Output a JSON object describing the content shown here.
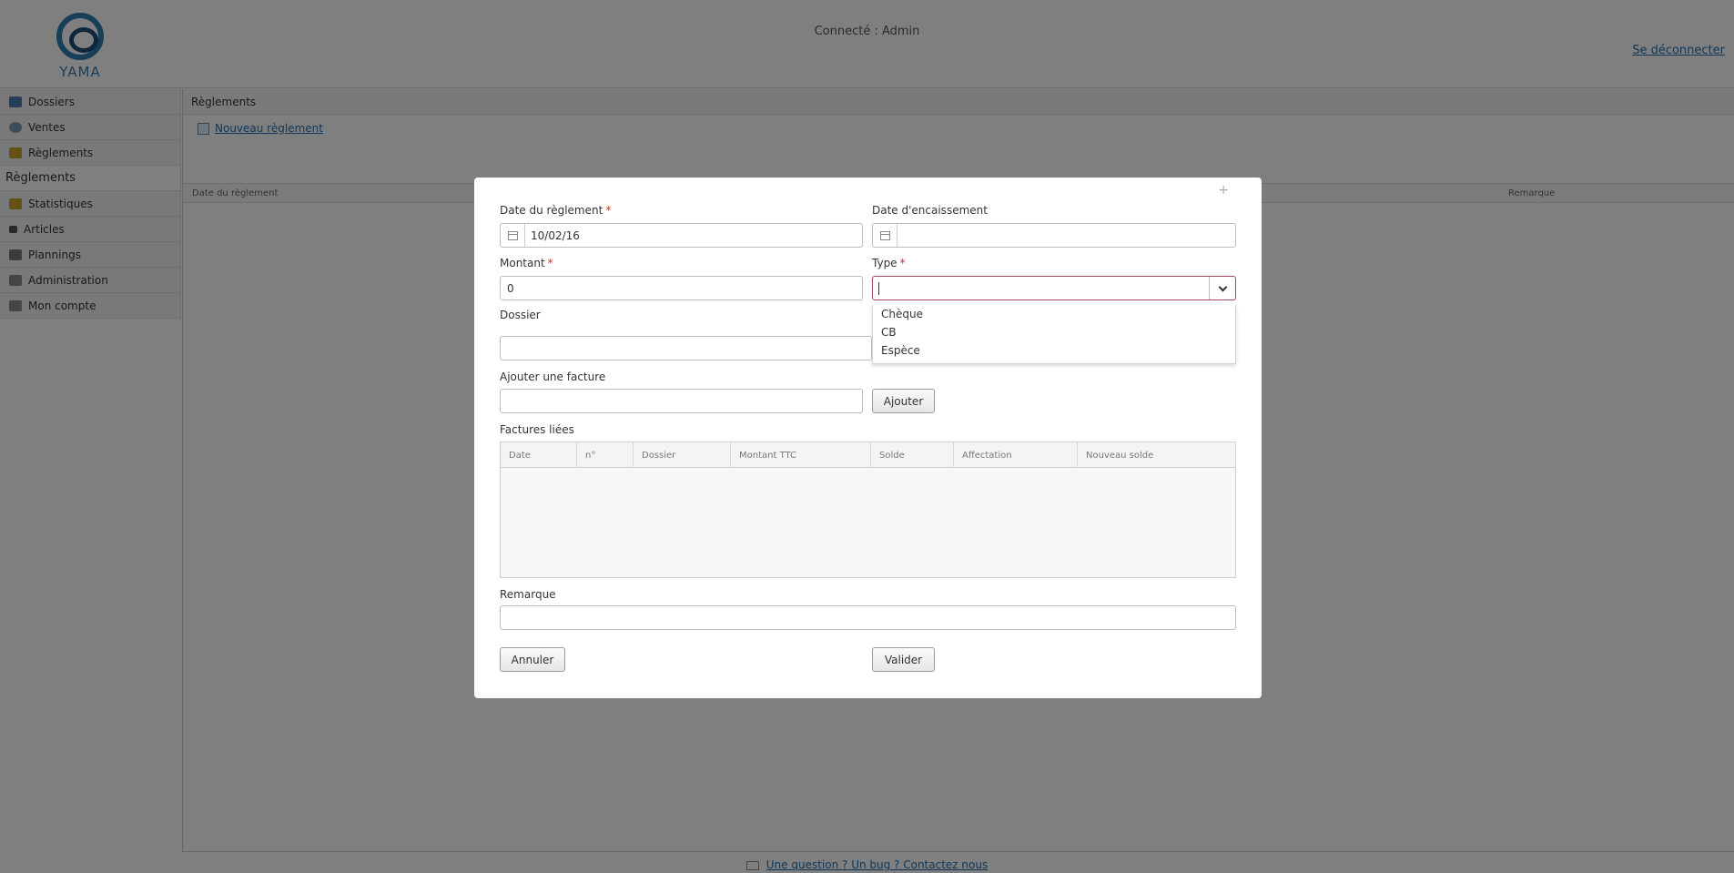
{
  "header": {
    "logo_text": "YAMA",
    "connected": "Connecté : Admin",
    "logout": "Se déconnecter"
  },
  "sidebar": {
    "items": [
      {
        "label": "Dossiers",
        "icon": "folder-icon",
        "color": "#4a7fb5"
      },
      {
        "label": "Ventes",
        "icon": "sales-icon",
        "color": "#7b9ab8"
      },
      {
        "label": "Règlements",
        "icon": "money-icon",
        "color": "#c9a22b"
      },
      {
        "label": "Règlements",
        "active": true
      },
      {
        "label": "Statistiques",
        "icon": "chart-icon",
        "color": "#c9a22b"
      },
      {
        "label": "Articles",
        "icon": "cart-icon",
        "color": "#555555"
      },
      {
        "label": "Plannings",
        "icon": "calendar-icon",
        "color": "#777777"
      },
      {
        "label": "Administration",
        "icon": "list-icon",
        "color": "#8a8a8a"
      },
      {
        "label": "Mon compte",
        "icon": "list-icon",
        "color": "#8a8a8a"
      }
    ]
  },
  "content": {
    "title": "Règlements",
    "new_link": "Nouveau règlement",
    "columns": {
      "date": "Date du règlement",
      "remark": "Remarque"
    }
  },
  "footer": {
    "link": "Une question ? Un bug ? Contactez nous"
  },
  "modal": {
    "close": "+",
    "date_reglement": {
      "label": "Date du règlement",
      "required": "*",
      "value": "10/02/16"
    },
    "date_encaissement": {
      "label": "Date d'encaissement",
      "value": ""
    },
    "montant": {
      "label": "Montant",
      "required": "*",
      "value": "0"
    },
    "type": {
      "label": "Type",
      "required": "*",
      "value": "",
      "options": [
        "Chèque",
        "CB",
        "Espèce"
      ]
    },
    "dossier": {
      "label": "Dossier",
      "value": ""
    },
    "facture": {
      "label": "Ajouter une facture",
      "value": "",
      "button": "Ajouter"
    },
    "factures_liees": {
      "label": "Factures liées",
      "columns": [
        "Date",
        "n°",
        "Dossier",
        "Montant TTC",
        "Solde",
        "Affectation",
        "Nouveau solde"
      ]
    },
    "remarque": {
      "label": "Remarque",
      "value": ""
    },
    "cancel": "Annuler",
    "validate": "Valider"
  },
  "colors": {
    "accent": "#1f6fb2",
    "required": "#c0392b",
    "focus_border": "#a8475a",
    "overlay": "rgba(0,0,0,0.5)"
  }
}
